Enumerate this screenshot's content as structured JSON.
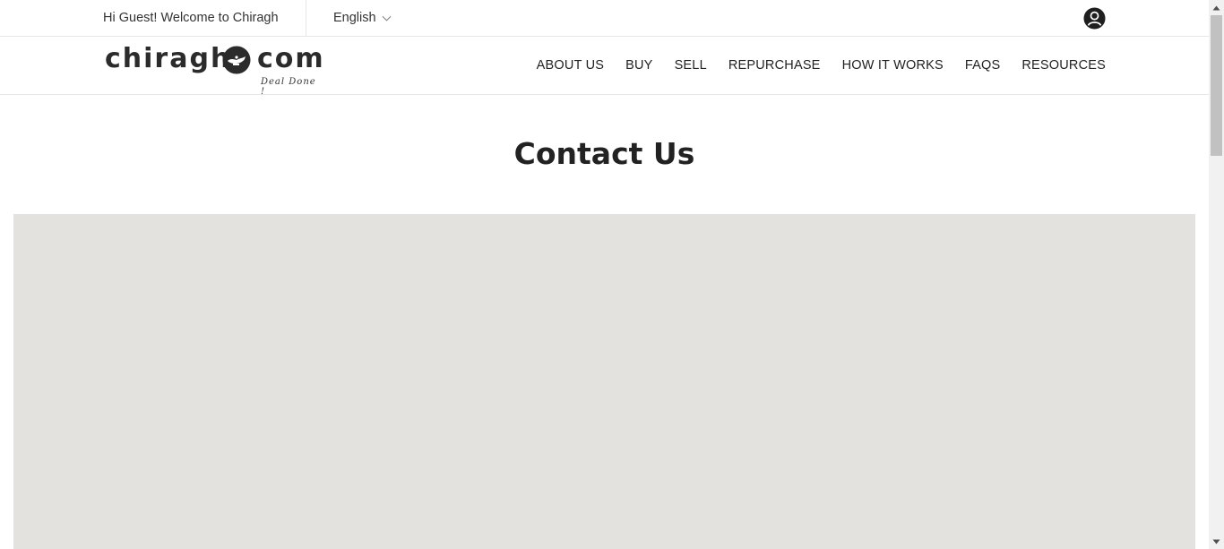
{
  "topbar": {
    "welcome_text": "Hi Guest! Welcome to Chiragh",
    "language": "English",
    "account_icon": "user-circle-icon"
  },
  "header": {
    "logo": {
      "left_word": "chiragh",
      "right_word": "com",
      "tagline": "Deal Done !",
      "icon": "lamp-icon"
    },
    "nav": [
      {
        "label": "ABOUT US"
      },
      {
        "label": "BUY"
      },
      {
        "label": "SELL"
      },
      {
        "label": "REPURCHASE"
      },
      {
        "label": "HOW IT WORKS"
      },
      {
        "label": "FAQS"
      },
      {
        "label": "RESOURCES"
      }
    ]
  },
  "main": {
    "title": "Contact Us",
    "map_color": "#e3e2df"
  },
  "colors": {
    "text": "#222222",
    "border": "#e6e6e6"
  }
}
